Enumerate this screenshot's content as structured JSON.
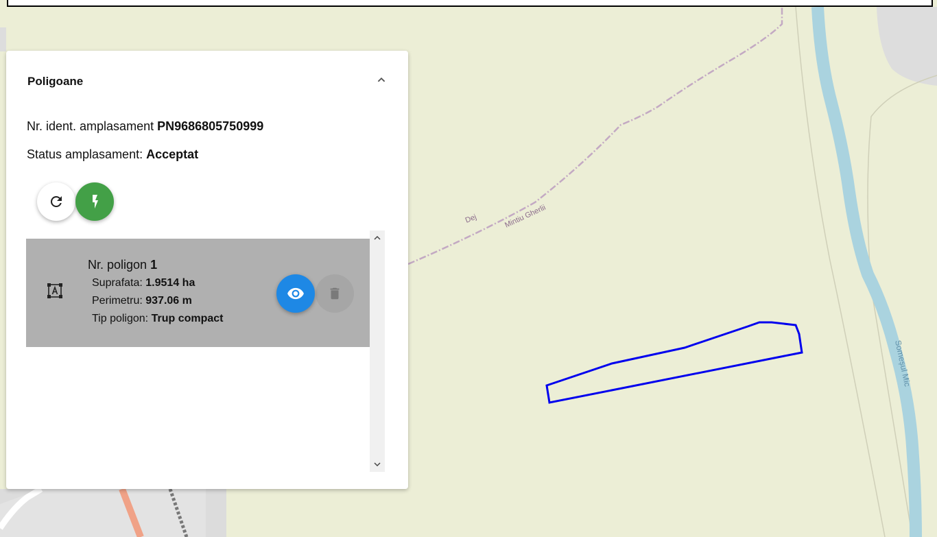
{
  "panel": {
    "title": "Poligoane",
    "ident_label": "Nr. ident. amplasament ",
    "ident_value": "PN9686805750999",
    "status_label": "Status amplasament: ",
    "status_value": "Acceptat"
  },
  "polygons": [
    {
      "title_label": "Nr. poligon ",
      "title_value": "1",
      "area_label": "Suprafata: ",
      "area_value": "1.9514 ha",
      "perimeter_label": "Perimetru: ",
      "perimeter_value": "937.06 m",
      "type_label": "Tip poligon: ",
      "type_value": "Trup compact"
    }
  ],
  "map": {
    "road_label_1": "Dej",
    "road_label_2": "Mintiu Gherlii",
    "river_label": "Someșul Mic",
    "polygon_color": "#0000ee",
    "river_color": "#aad3df",
    "background_color": "#eceed6"
  },
  "colors": {
    "power_button": "#43a047",
    "view_button": "#1e88e5"
  },
  "icons": {
    "collapse": "chevron-up-icon",
    "refresh": "refresh-icon",
    "power": "bolt-icon",
    "polygon": "polygon-shape-icon",
    "view": "eye-icon",
    "delete": "trash-icon"
  }
}
